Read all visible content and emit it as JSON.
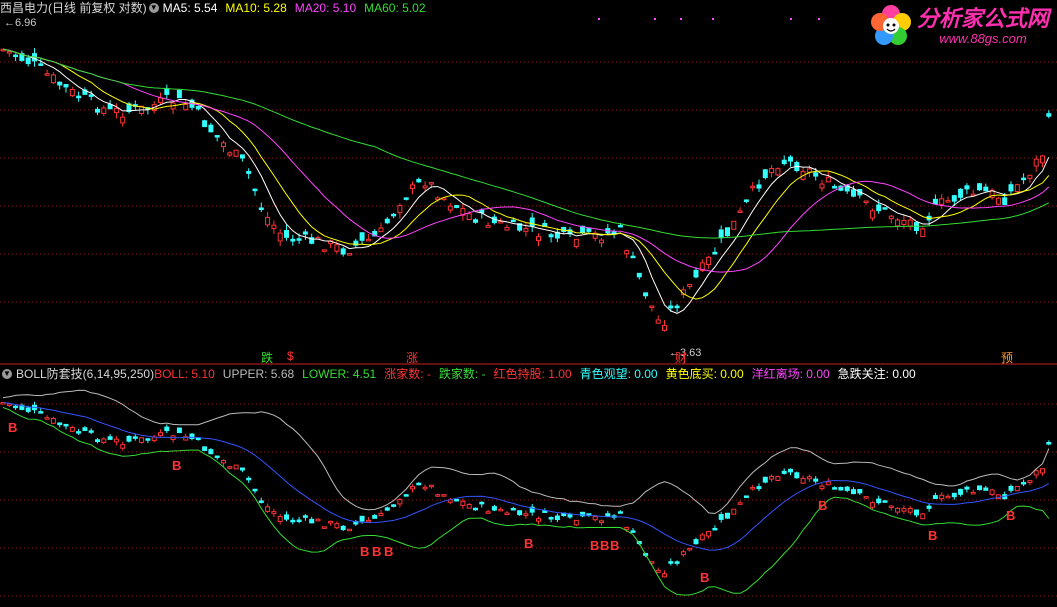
{
  "top_legend": {
    "title": "西昌电力(日线 前复权 对数)",
    "items": [
      {
        "label": "MA5: 5.54",
        "color": "#ffffff"
      },
      {
        "label": "MA10: 5.28",
        "color": "#ffff00"
      },
      {
        "label": "MA20: 5.10",
        "color": "#ff44ff"
      },
      {
        "label": "MA60: 5.02",
        "color": "#33dd33"
      }
    ]
  },
  "bottom_legend": {
    "title": "BOLL防套技(6,14,95,250)",
    "items": [
      {
        "label": "BOLL: 5.10",
        "color": "#ff3333"
      },
      {
        "label": "UPPER: 5.68",
        "color": "#bbbbbb"
      },
      {
        "label": "LOWER: 4.51",
        "color": "#33dd33"
      },
      {
        "label": "涨家数: -",
        "color": "#ff3333"
      },
      {
        "label": "跌家数: -",
        "color": "#33dd33"
      },
      {
        "label": "红色持股: 1.00",
        "color": "#ff3333"
      },
      {
        "label": "青色观望: 0.00",
        "color": "#33ffff"
      },
      {
        "label": "黄色底买: 0.00",
        "color": "#ffff00"
      },
      {
        "label": "洋红离场: 0.00",
        "color": "#ff44ff"
      },
      {
        "label": "急跌关注: 0.00",
        "color": "#ffffff"
      }
    ]
  },
  "logo": {
    "main": "分析家公式网",
    "url": "www.88gs.com"
  },
  "annotations": {
    "high_label": "6.96",
    "low_label": "3.63"
  },
  "markers": [
    {
      "text": "跌",
      "color": "#33dd33"
    },
    {
      "text": "$",
      "color": "#ff3333"
    },
    {
      "text": "涨",
      "color": "#ff3333"
    },
    {
      "text": "财",
      "color": "#ff3333"
    },
    {
      "text": "预",
      "color": "#ff9933"
    }
  ],
  "b_signal": {
    "text": "B",
    "color": "#ff3333"
  },
  "colors": {
    "up": "#ff3333",
    "down": "#33ffff",
    "grid": "#8a1a1a",
    "divider": "#cc2222"
  }
}
